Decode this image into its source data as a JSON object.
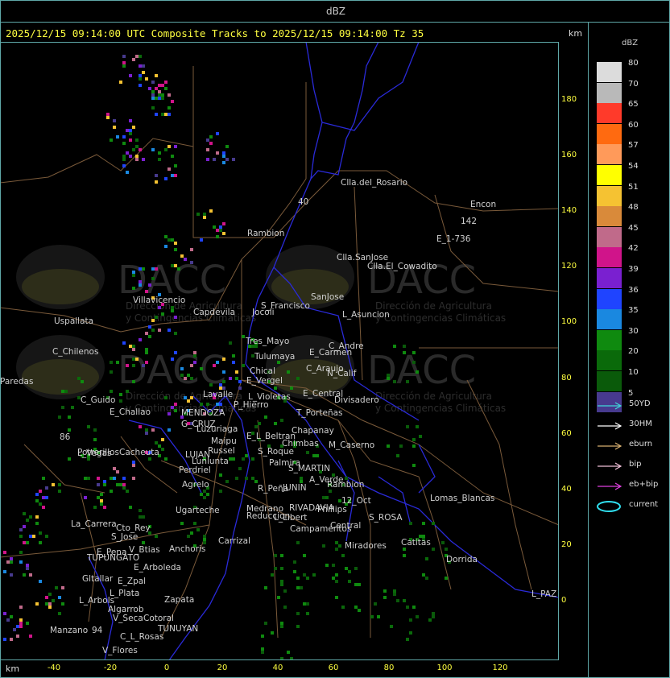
{
  "header": {
    "units_title": "dBZ"
  },
  "map": {
    "caption": "2025/12/15 09:14:00 UTC Composite Tracks to 2025/12/15 09:14:00 Tz 35",
    "km_label_top": "km",
    "km_label_bottom": "km",
    "y_ticks": [
      "180",
      "160",
      "140",
      "120",
      "100",
      "80",
      "60",
      "40",
      "20",
      "0"
    ],
    "x_ticks": [
      "-40",
      "-20",
      "0",
      "20",
      "40",
      "60",
      "80",
      "100",
      "120"
    ],
    "places": [
      "Clla.del_Rosario",
      "Encon",
      "E_1-736",
      "142",
      "Rambion",
      "Clla.SanJose",
      "Clla.El_Cowadito",
      "Villavicencio",
      "Uspallata",
      "S_Francisco",
      "SanJose",
      "L_Asuncion",
      "Capdevila",
      "Tres_Mayo",
      "Jocoli",
      "Tulumaya",
      "C_Andre",
      "E_Carmen",
      "C_Chilenos",
      "Chical",
      "E_Vergel",
      "C_Araujo",
      "N_Calif",
      "Paredas",
      "Lavalle",
      "L_Violetas",
      "E_Central",
      "Divisadero",
      "C_Guido",
      "E_Challao",
      "MENDOZA",
      "P_Hierro",
      "T_Porteñas",
      "G_CRUZ",
      "Luzuriaga",
      "Chapanay",
      "Maipu",
      "E_L_Beltran",
      "Chimbas",
      "M_Caserno",
      "Russel",
      "S_Roque",
      "Potrerillos",
      "Cacheuta",
      "L_Vegas",
      "LUJAN",
      "Lunlunta",
      "Palmira",
      "Perdriel",
      "S_MARTIN",
      "A_Verde",
      "Rambion",
      "Agrelo",
      "R_Peña",
      "JUNIN",
      "Ugarteche",
      "Medrano",
      "Reduccion",
      "RIVADAVIA",
      "Phillips",
      "12_Oct",
      "Lomas_Blancas",
      "La_Carrera",
      "Cto_Rey",
      "S_Jose",
      "L_Libert",
      "Campamentos",
      "Central",
      "S_ROSA",
      "E_Pena",
      "V_Btias",
      "Anchoris",
      "Carrizal",
      "Miradores",
      "Catitas",
      "Dorrida",
      "TUPUNGATO",
      "E_Arboleda",
      "Gltallar",
      "E_Zpal",
      "L_Plata",
      "L_Arbols",
      "Algarrob",
      "Zapata",
      "L_PAZ",
      "V_Seca",
      "Cotoral",
      "TUNUYAN",
      "Manzano",
      "94",
      "C_L_Rosas",
      "V_Flores",
      "86",
      "40"
    ],
    "watermark": {
      "brand": "DACC",
      "line1": "Dirección de Agricultura",
      "line2": "y Contingencias Climáticas"
    }
  },
  "legend": {
    "title": "dBZ",
    "scale": [
      {
        "label": "80",
        "color": "#dcdcdc"
      },
      {
        "label": "70",
        "color": "#b9b9b9"
      },
      {
        "label": "65",
        "color": "#ff3a2a"
      },
      {
        "label": "60",
        "color": "#ff6a10"
      },
      {
        "label": "57",
        "color": "#ff9a5a"
      },
      {
        "label": "54",
        "color": "#ffff00"
      },
      {
        "label": "51",
        "color": "#f5c232"
      },
      {
        "label": "48",
        "color": "#d98a3a"
      },
      {
        "label": "45",
        "color": "#c06a8a"
      },
      {
        "label": "42",
        "color": "#d0148a"
      },
      {
        "label": "39",
        "color": "#7a20d0"
      },
      {
        "label": "36",
        "color": "#1f44ff"
      },
      {
        "label": "35",
        "color": "#1a88e0"
      },
      {
        "label": "30",
        "color": "#0f8a0f"
      },
      {
        "label": "20",
        "color": "#0a6a0a"
      },
      {
        "label": "10",
        "color": "#0a5a0a"
      },
      {
        "label": "5",
        "color": "#473a8e"
      }
    ],
    "tracks": [
      {
        "label": "50YD",
        "color": "#40d8d8",
        "icon": "arrow-icon"
      },
      {
        "label": "30HM",
        "color": "#ffffff",
        "icon": "arrow-icon"
      },
      {
        "label": "eburn",
        "color": "#d8b070",
        "icon": "arrow-icon"
      },
      {
        "label": "bip",
        "color": "#f0c0d8",
        "icon": "arrow-icon"
      },
      {
        "label": "eb+bip",
        "color": "#e040e0",
        "icon": "arrow-icon"
      },
      {
        "label": "current",
        "color": "#30e0f0",
        "icon": "ellipse-icon"
      }
    ]
  }
}
